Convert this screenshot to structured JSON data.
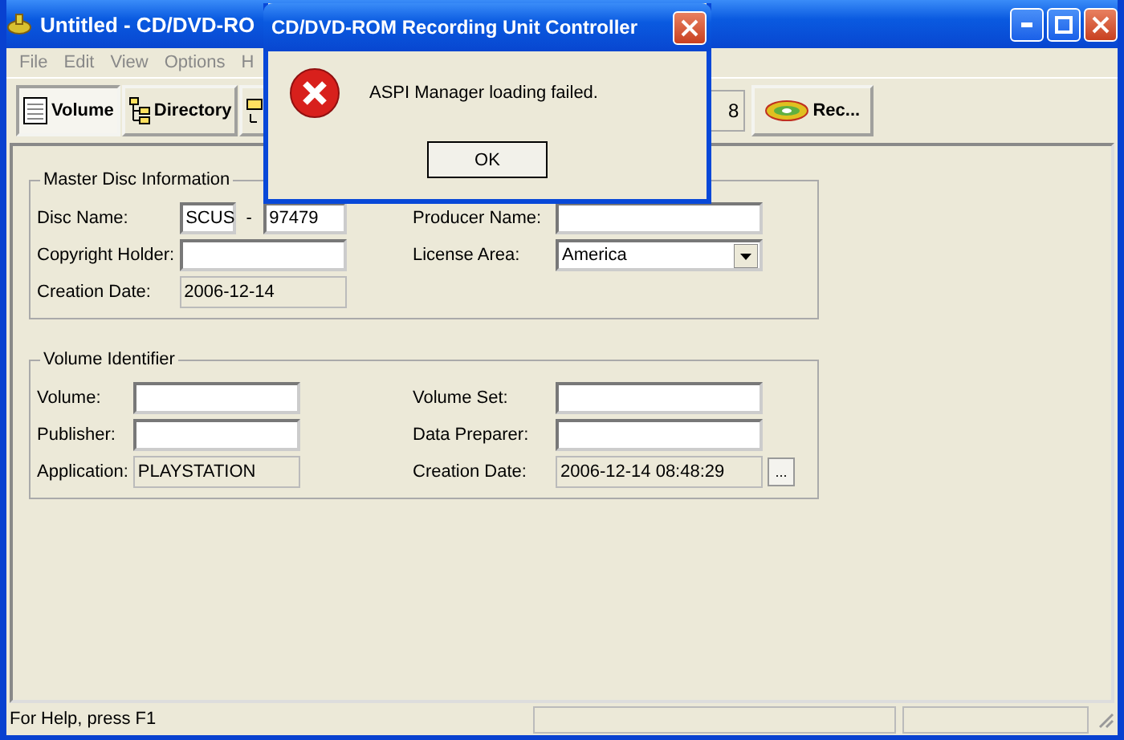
{
  "window": {
    "title": "Untitled - CD/DVD-RO"
  },
  "menu": [
    "File",
    "Edit",
    "View",
    "Options",
    "H"
  ],
  "tabs": [
    {
      "label": "Volume",
      "selected": true
    },
    {
      "label": "Directory",
      "selected": false
    },
    {
      "selected": false
    }
  ],
  "toolbar_field": {
    "value": "8"
  },
  "record_button": {
    "label": "Rec..."
  },
  "groups": [
    {
      "title": "Master Disc Information",
      "left": [
        {
          "kind": "split",
          "label": "Disc Name:",
          "prefix": "SCUS",
          "separator": "-",
          "value": "97479"
        },
        {
          "kind": "text",
          "label": "Copyright Holder:"
        },
        {
          "kind": "readonly",
          "label": "Creation Date:",
          "value": "2006-12-14"
        }
      ],
      "right": [
        {
          "kind": "text",
          "label": "Producer Name:"
        },
        {
          "kind": "dropdown",
          "label": "License Area:",
          "value": "America"
        }
      ]
    },
    {
      "title": "Volume Identifier",
      "left": [
        {
          "kind": "text",
          "label": "Volume:"
        },
        {
          "kind": "text",
          "label": "Publisher:"
        },
        {
          "kind": "readonly",
          "label": "Application:",
          "value": "PLAYSTATION"
        }
      ],
      "right": [
        {
          "kind": "text",
          "label": "Volume Set:"
        },
        {
          "kind": "text",
          "label": "Data Preparer:"
        },
        {
          "kind": "picker",
          "label": "Creation Date:",
          "value": "2006-12-14 08:48:29",
          "button": "..."
        }
      ]
    }
  ],
  "status_bar": {
    "text": "For Help, press F1"
  },
  "dialog": {
    "title": "CD/DVD-ROM Recording Unit Controller",
    "message": "ASPI Manager loading failed.",
    "button": "OK"
  }
}
